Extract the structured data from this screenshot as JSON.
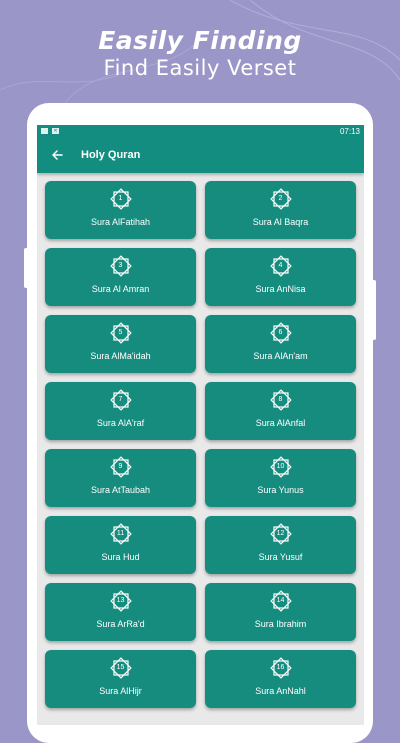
{
  "promo": {
    "headline": "Easily Finding",
    "subheadline": "Find Easily Verset"
  },
  "status_bar": {
    "time": "07:13",
    "icons": [
      "image-icon",
      "x-notification-icon"
    ]
  },
  "app_bar": {
    "back_icon": "arrow-left-icon",
    "title": "Holy Quran"
  },
  "colors": {
    "background": "#9b96c8",
    "primary": "#138d7f",
    "card": "#168c7f",
    "screen_bg": "#e9e9e9"
  },
  "suras": [
    {
      "number": "1",
      "name": "Sura AlFatihah"
    },
    {
      "number": "2",
      "name": "Sura Al Baqra"
    },
    {
      "number": "3",
      "name": "Sura Al Amran"
    },
    {
      "number": "4",
      "name": "Sura AnNisa"
    },
    {
      "number": "5",
      "name": "Sura AlMa'idah"
    },
    {
      "number": "6",
      "name": "Sura AlAn'am"
    },
    {
      "number": "7",
      "name": "Sura AlA'raf"
    },
    {
      "number": "8",
      "name": "Sura AlAnfal"
    },
    {
      "number": "9",
      "name": "Sura AtTaubah"
    },
    {
      "number": "10",
      "name": "Sura Yunus"
    },
    {
      "number": "11",
      "name": "Sura Hud"
    },
    {
      "number": "12",
      "name": "Sura Yusuf"
    },
    {
      "number": "13",
      "name": "Sura ArRa'd"
    },
    {
      "number": "14",
      "name": "Sura Ibrahim"
    },
    {
      "number": "15",
      "name": "Sura AlHijr"
    },
    {
      "number": "16",
      "name": "Sura AnNahl"
    }
  ]
}
